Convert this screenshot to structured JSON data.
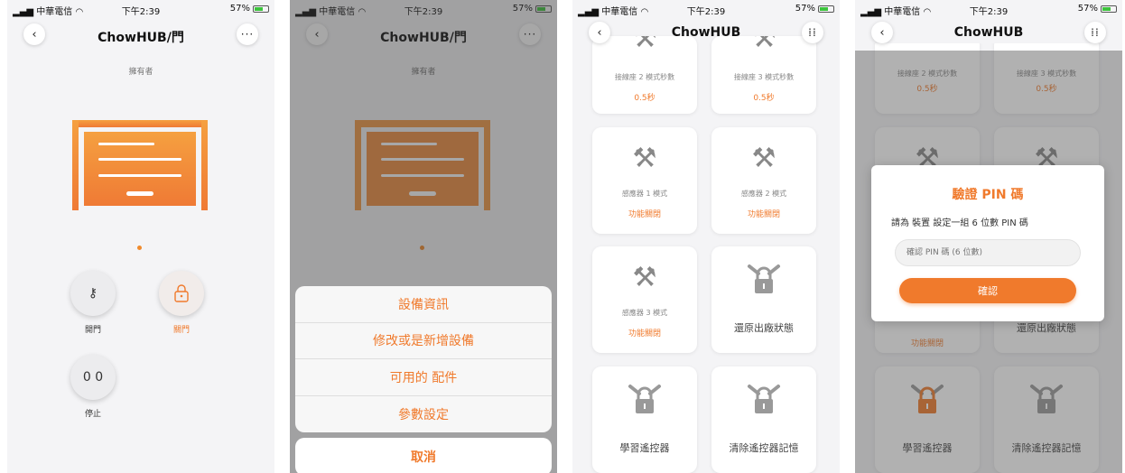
{
  "status": {
    "carrier": "中華電信",
    "time": "下午2:39",
    "battery": "57%"
  },
  "screen1": {
    "title": "ChowHUB/門",
    "owner": "擁有者",
    "controls": {
      "open_label": "開門",
      "close_label": "關門",
      "stop_label": "停止",
      "stop_glyph": "0 0"
    }
  },
  "screen2": {
    "title": "ChowHUB/門",
    "owner": "擁有者",
    "menu": [
      "設備資訊",
      "修改或是新增設備",
      "可用的 配件",
      "參數設定"
    ],
    "cancel": "取消"
  },
  "screen3": {
    "title": "ChowHUB",
    "cards": [
      {
        "title": "接線座 2 模式秒數",
        "value": "0.5秒"
      },
      {
        "title": "接線座 3 模式秒數",
        "value": "0.5秒"
      },
      {
        "title": "感應器 1 模式",
        "value": "功能關閉"
      },
      {
        "title": "感應器 2 模式",
        "value": "功能關閉"
      },
      {
        "title": "感應器 3 模式",
        "value": "功能關閉"
      },
      {
        "title": "還原出廠狀態"
      },
      {
        "title": "學習遙控器"
      },
      {
        "title": "清除遙控器記憶"
      }
    ]
  },
  "screen4": {
    "title": "ChowHUB",
    "modal": {
      "title": "驗證 PIN 碼",
      "desc": "請為 裝置 設定一組 6 位數 PIN 碼",
      "placeholder": "確認 PIN 碼 (6 位數)",
      "confirm": "確認"
    },
    "bg_cards": [
      {
        "title": "接線座 2 模式秒數",
        "value": "0.5秒"
      },
      {
        "title": "接線座 3 模式秒數",
        "value": "0.5秒"
      },
      {
        "value": "功能關閉"
      },
      {
        "title": "還原出廠狀態"
      },
      {
        "title": "學習遙控器"
      },
      {
        "title": "清除遙控器記憶"
      }
    ]
  },
  "icons": {
    "back": "chevron-left-icon",
    "more": "more-icon",
    "grid": "grid-icon",
    "tools": "tools-icon",
    "lock": "padlock-chain-icon",
    "key": "key-icon"
  },
  "colors": {
    "accent": "#f07a2c",
    "accent_light": "#f5a040",
    "background": "#f4f4f6"
  }
}
